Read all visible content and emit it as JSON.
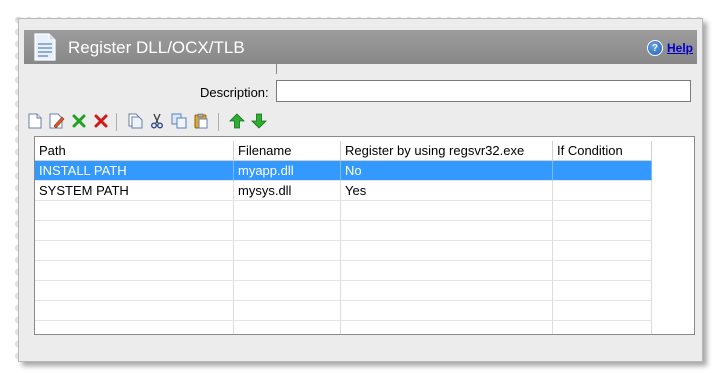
{
  "header": {
    "title": "Register DLL/OCX/TLB",
    "help_label": "Help"
  },
  "form": {
    "description_label": "Description:",
    "description_value": ""
  },
  "toolbar": {
    "buttons": [
      "new-icon",
      "edit-icon",
      "check-icon",
      "delete-icon",
      "copy-icon",
      "cut-icon",
      "duplicate-icon",
      "paste-icon",
      "move-up-icon",
      "move-down-icon"
    ]
  },
  "table": {
    "columns": [
      "Path",
      "Filename",
      "Register by using regsvr32.exe",
      "If Condition"
    ],
    "rows": [
      {
        "path": "INSTALL PATH",
        "filename": "myapp.dll",
        "regsvr32": "No",
        "condition": ""
      },
      {
        "path": "SYSTEM PATH",
        "filename": "mysys.dll",
        "regsvr32": "Yes",
        "condition": ""
      }
    ],
    "selected_row": 0
  },
  "colors": {
    "header_bg": "#8f8f8f",
    "selection": "#3399ff",
    "link": "#0000cc"
  }
}
